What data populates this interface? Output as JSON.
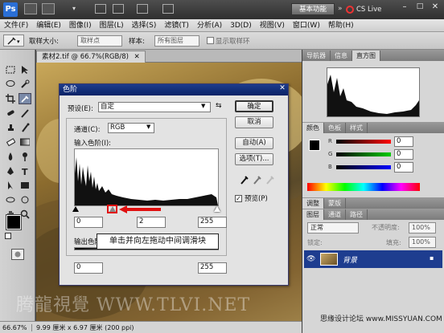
{
  "app": {
    "logo": "Ps",
    "workspace_button": "基本功能",
    "cs_live": "CS Live"
  },
  "menu": [
    "文件(F)",
    "编辑(E)",
    "图像(I)",
    "图层(L)",
    "选择(S)",
    "滤镜(T)",
    "分析(A)",
    "3D(D)",
    "视图(V)",
    "窗口(W)",
    "帮助(H)"
  ],
  "options": {
    "sample_size_label": "取样大小:",
    "sample_size_value": "取样点",
    "sample_label": "样本:",
    "sample_value": "所有图层",
    "show_ring_label": "显示取样环"
  },
  "document": {
    "tab_title": "素材2.tif @ 66.7%(RGB/8)",
    "zoom": "66.67%",
    "dimensions": "9.99 厘米 x 6.97 厘米 (200 ppi)"
  },
  "panels": {
    "top_tabs": [
      "导航器",
      "信息",
      "直方图"
    ],
    "color_tabs": [
      "颜色",
      "色板",
      "样式"
    ],
    "color_values": {
      "r": "0",
      "g": "0",
      "b": "0"
    },
    "adjust_tabs": [
      "调整",
      "蒙版"
    ],
    "layer_tabs": [
      "图层",
      "通道",
      "路径"
    ],
    "blend_mode": "正常",
    "opacity_label": "不透明度:",
    "opacity": "100%",
    "lock_label": "锁定:",
    "fill_label": "填充:",
    "fill": "100%",
    "layer_name": "背景"
  },
  "dialog": {
    "title": "色阶",
    "preset_label": "预设(E):",
    "preset_value": "自定",
    "channel_label": "通道(C):",
    "channel_value": "RGB",
    "input_label": "输入色阶(I):",
    "input_black": "0",
    "input_mid": "2",
    "input_white": "255",
    "output_label": "输出色阶",
    "output_black": "0",
    "output_white": "255",
    "ok": "确定",
    "cancel": "取消",
    "auto": "自动(A)",
    "options": "选项(T)...",
    "preview": "预览(P)",
    "preview_checked": true
  },
  "callout": "单击并向左拖动中间调滑块",
  "watermark": "腾龍視覺 WWW.TLVI.NET",
  "watermark2": "思缘设计论坛 www.MISSYUAN.COM",
  "colors": {
    "accent": "#0a2266",
    "highlight": "#e01010"
  }
}
